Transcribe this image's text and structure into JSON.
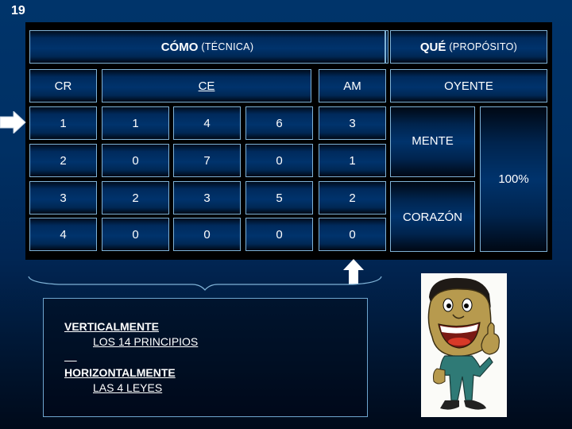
{
  "slide_number": "19",
  "table": {
    "header_how": {
      "bold": "CÓMO",
      "sub": "(TÉCNICA)"
    },
    "header_what": {
      "bold": "QUÉ",
      "sub": "(PROPÓSITO)"
    },
    "col_cr": "CR",
    "col_ce": "CE",
    "col_am": "AM",
    "col_listener": "OYENTE",
    "rows": [
      [
        "1",
        "1",
        "4",
        "6",
        "3"
      ],
      [
        "2",
        "0",
        "7",
        "0",
        "1"
      ],
      [
        "3",
        "2",
        "3",
        "5",
        "2"
      ],
      [
        "4",
        "0",
        "0",
        "0",
        "0"
      ]
    ],
    "mind": "MENTE",
    "heart": "CORAZÓN",
    "total": "100%"
  },
  "notes": {
    "vertical_label": "VERTICALMENTE",
    "vertical_item": "LOS 14 PRINCIPIOS",
    "separator": "__",
    "horizontal_label": "HORIZONTALMENTE",
    "horizontal_item": "LAS 4 LEYES"
  },
  "icons": {
    "row_pointer": "arrow-right-icon",
    "column_pointer": "arrow-up-icon",
    "brace": "curly-brace-icon",
    "character": "thumbs-up-cartoon-man"
  },
  "colors": {
    "background": "#003064",
    "cell_border": "#7fb2d6",
    "panel": "#000000",
    "text": "#ffffff"
  }
}
